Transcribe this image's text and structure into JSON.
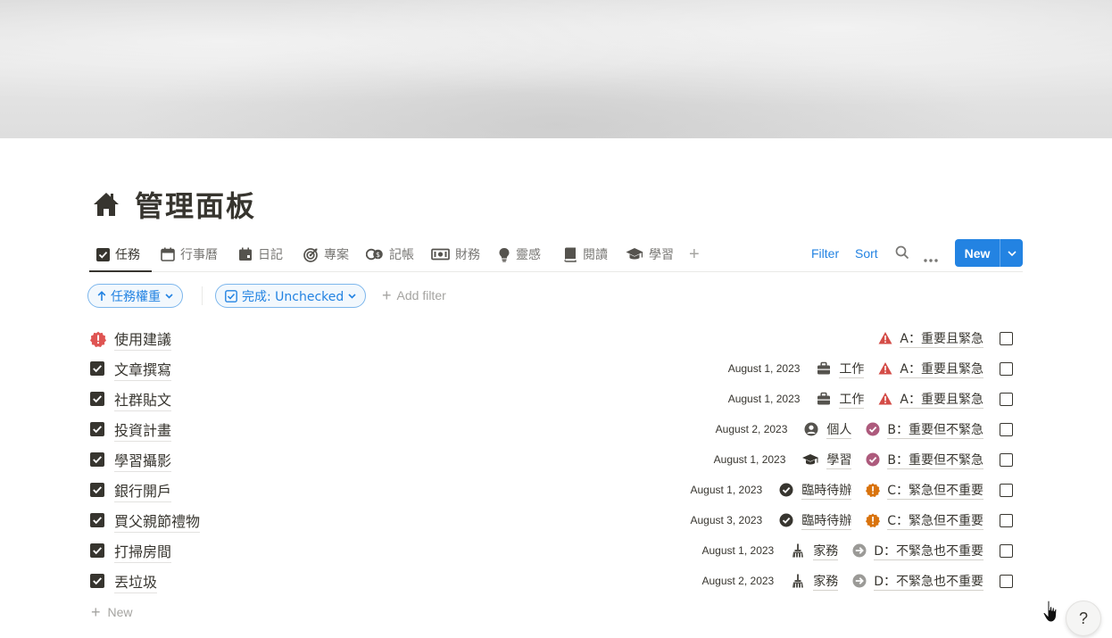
{
  "page": {
    "title": "管理面板",
    "icon": "house-icon"
  },
  "tabs": [
    {
      "label": "任務",
      "icon": "checkbox-icon",
      "active": true
    },
    {
      "label": "行事曆",
      "icon": "calendar-icon"
    },
    {
      "label": "日記",
      "icon": "journal-icon"
    },
    {
      "label": "專案",
      "icon": "target-icon"
    },
    {
      "label": "記帳",
      "icon": "coins-icon"
    },
    {
      "label": "財務",
      "icon": "money-icon"
    },
    {
      "label": "靈感",
      "icon": "lightbulb-icon"
    },
    {
      "label": "閱讀",
      "icon": "book-icon"
    },
    {
      "label": "學習",
      "icon": "graduation-cap-icon"
    }
  ],
  "toolbar": {
    "filter_label": "Filter",
    "sort_label": "Sort",
    "new_label": "New"
  },
  "filters": {
    "sort_pill": "任務權重",
    "filter_pill": "完成: Unchecked",
    "add_filter": "Add filter"
  },
  "rows": [
    {
      "name": "使用建議",
      "type": "alert",
      "date": "",
      "category": "",
      "category_icon": "",
      "priority": "A：重要且緊急",
      "priority_icon": "warning-icon"
    },
    {
      "name": "文章撰寫",
      "type": "check",
      "date": "August 1, 2023",
      "category": "工作",
      "category_icon": "briefcase-icon",
      "priority": "A：重要且緊急",
      "priority_icon": "warning-icon"
    },
    {
      "name": "社群貼文",
      "type": "check",
      "date": "August 1, 2023",
      "category": "工作",
      "category_icon": "briefcase-icon",
      "priority": "A：重要且緊急",
      "priority_icon": "warning-icon"
    },
    {
      "name": "投資計畫",
      "type": "check",
      "date": "August 2, 2023",
      "category": "個人",
      "category_icon": "user-icon",
      "priority": "B：重要但不緊急",
      "priority_icon": "check-circle-icon"
    },
    {
      "name": "學習攝影",
      "type": "check",
      "date": "August 1, 2023",
      "category": "學習",
      "category_icon": "graduation-cap-icon",
      "priority": "B：重要但不緊急",
      "priority_icon": "check-circle-icon"
    },
    {
      "name": "銀行開戶",
      "type": "check",
      "date": "August 1, 2023",
      "category": "臨時待辦",
      "category_icon": "check-badge-icon",
      "priority": "C：緊急但不重要",
      "priority_icon": "alert-badge-icon"
    },
    {
      "name": "買父親節禮物",
      "type": "check",
      "date": "August 3, 2023",
      "category": "臨時待辦",
      "category_icon": "check-badge-icon",
      "priority": "C：緊急但不重要",
      "priority_icon": "alert-badge-icon"
    },
    {
      "name": "打掃房間",
      "type": "check",
      "date": "August 1, 2023",
      "category": "家務",
      "category_icon": "broom-icon",
      "priority": "D：不緊急也不重要",
      "priority_icon": "arrow-circle-icon"
    },
    {
      "name": "丟垃圾",
      "type": "check",
      "date": "August 2, 2023",
      "category": "家務",
      "category_icon": "broom-icon",
      "priority": "D：不緊急也不重要",
      "priority_icon": "arrow-circle-icon"
    }
  ],
  "new_row_label": "New",
  "help_label": "?",
  "colors": {
    "accent": "#2383e2",
    "priority_a": "#d44c47",
    "priority_b": "#ad5a7c",
    "priority_c": "#d9730d",
    "priority_d": "#9b9a97",
    "alert": "#df5452"
  }
}
